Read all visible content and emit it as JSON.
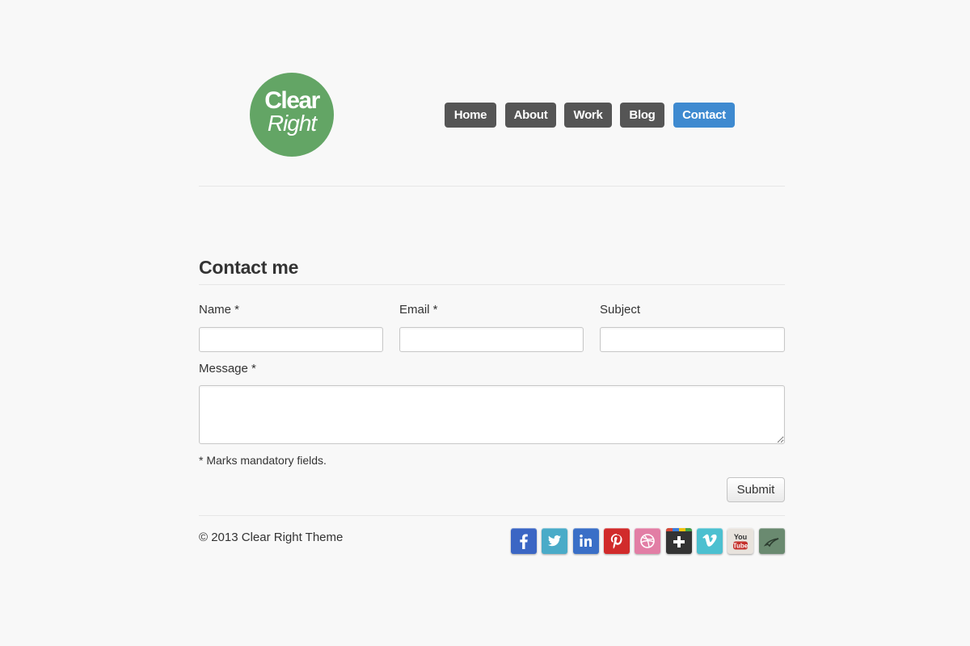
{
  "logo": {
    "line1": "Clear",
    "line2": "Right"
  },
  "nav": {
    "items": [
      {
        "label": "Home",
        "active": false
      },
      {
        "label": "About",
        "active": false
      },
      {
        "label": "Work",
        "active": false
      },
      {
        "label": "Blog",
        "active": false
      },
      {
        "label": "Contact",
        "active": true
      }
    ]
  },
  "contact": {
    "heading": "Contact me",
    "fields": {
      "name": {
        "label": "Name *",
        "value": "",
        "placeholder": ""
      },
      "email": {
        "label": "Email *",
        "value": "",
        "placeholder": ""
      },
      "subject": {
        "label": "Subject",
        "value": "",
        "placeholder": ""
      },
      "message": {
        "label": "Message *",
        "value": "",
        "placeholder": ""
      }
    },
    "note": "* Marks mandatory fields.",
    "submit_label": "Submit"
  },
  "footer": {
    "copyright": "© 2013 Clear Right Theme",
    "social": [
      {
        "icon": "facebook-icon",
        "color": "#3b66c4"
      },
      {
        "icon": "twitter-icon",
        "color": "#4aabc8"
      },
      {
        "icon": "linkedin-icon",
        "color": "#3a6fc7"
      },
      {
        "icon": "pinterest-icon",
        "color": "#d12b2b"
      },
      {
        "icon": "dribbble-icon",
        "color": "#e27ea5"
      },
      {
        "icon": "google-plus-icon",
        "color": "#333333"
      },
      {
        "icon": "vimeo-icon",
        "color": "#4cc0d0"
      },
      {
        "icon": "youtube-icon",
        "color": "#e8e3dd"
      },
      {
        "icon": "deviantart-icon",
        "color": "#6a8a70"
      }
    ]
  },
  "colors": {
    "accent": "#3e8ad0",
    "nav_default": "#555555",
    "logo": "#63a565",
    "background": "#f8f8f8"
  }
}
